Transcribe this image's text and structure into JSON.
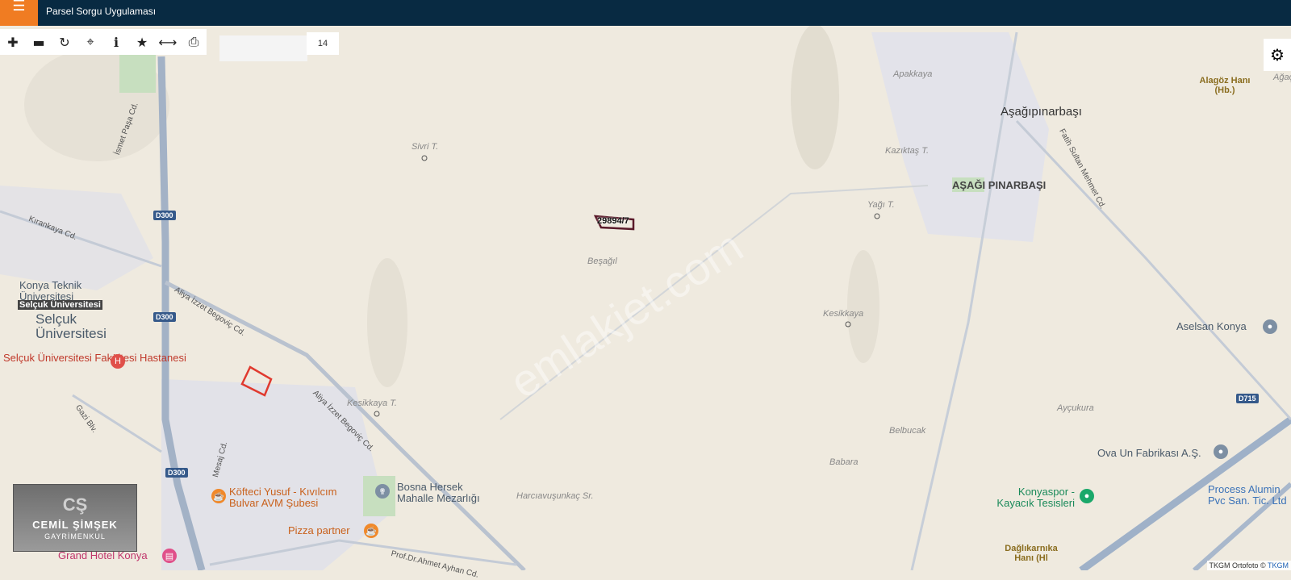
{
  "header": {
    "title": "Parsel Sorgu Uygulaması"
  },
  "toolbar": {
    "search_placeholder": "",
    "zoom_level": "14"
  },
  "icons": {
    "menu": "hamburger-icon",
    "zoom_in": "plus-icon",
    "zoom_out": "minus-icon",
    "refresh": "refresh-icon",
    "locate": "crosshair-icon",
    "info": "info-icon",
    "favorite": "star-icon",
    "measure": "arrows-horizontal-icon",
    "print": "print-icon",
    "settings": "gear-icon"
  },
  "colors": {
    "header": "#082a42",
    "menu_button": "#f07c22",
    "parcel": "#e03a2f"
  },
  "map": {
    "parcel_label": "29894/7",
    "watermark": "emlakjet.com",
    "towns": [
      "Aşağıpınarbaşı",
      "AŞAĞI PINARBAŞI",
      "Selçuk Üniversitesi",
      "Konya Teknik Üniversitesi",
      "Selçuk Üniversitesi"
    ],
    "small_places": [
      "Sivri T.",
      "Beşağıl",
      "Yağı T.",
      "Kesikkaya T.",
      "Kesikkaya",
      "Apakkaya",
      "Kazıktaş T.",
      "Belbucak",
      "Babara",
      "Harcıavuşunkaç Sr.",
      "Ayçukura",
      "Alagöz Hanı (Hb.)",
      "Ağaç",
      "Dağlıkarnıka Hanı (Hl"
    ],
    "roads": [
      "İsmet Paşa Cd.",
      "Kırankaya Cd.",
      "Aliya İzzet Begoviç Cd.",
      "Aliya İzzet Begoviç Cd.",
      "Gazi Blv.",
      "Mesaj Cd.",
      "Prof.Dr.Ahmet Ayhan Cd.",
      "Fatih Sultan Mehmet Cd."
    ],
    "shields": [
      "D300",
      "D300",
      "D300",
      "D715"
    ],
    "pois": [
      "Selçuk Üniversitesi Fakültesi Hastanesi",
      "Köfteci Yusuf - Kıvılcım Bulvar AVM Şubesi",
      "Bosna Hersek Mahalle Mezarlığı",
      "Pizza partner",
      "Grand Hotel Konya",
      "Aselsan Konya",
      "Ova Un Fabrikası A.Ş.",
      "Konyaspor - Kayacık Tesisleri",
      "Process Alumin Pvc San. Tic. Ltd"
    ]
  },
  "logo": {
    "mark": "CŞ",
    "name": "CEMİL ŞİMŞEK",
    "subtitle": "GAYRİMENKUL"
  },
  "attribution": {
    "text": "TKGM Ortofoto ©",
    "link": "TKGM"
  }
}
